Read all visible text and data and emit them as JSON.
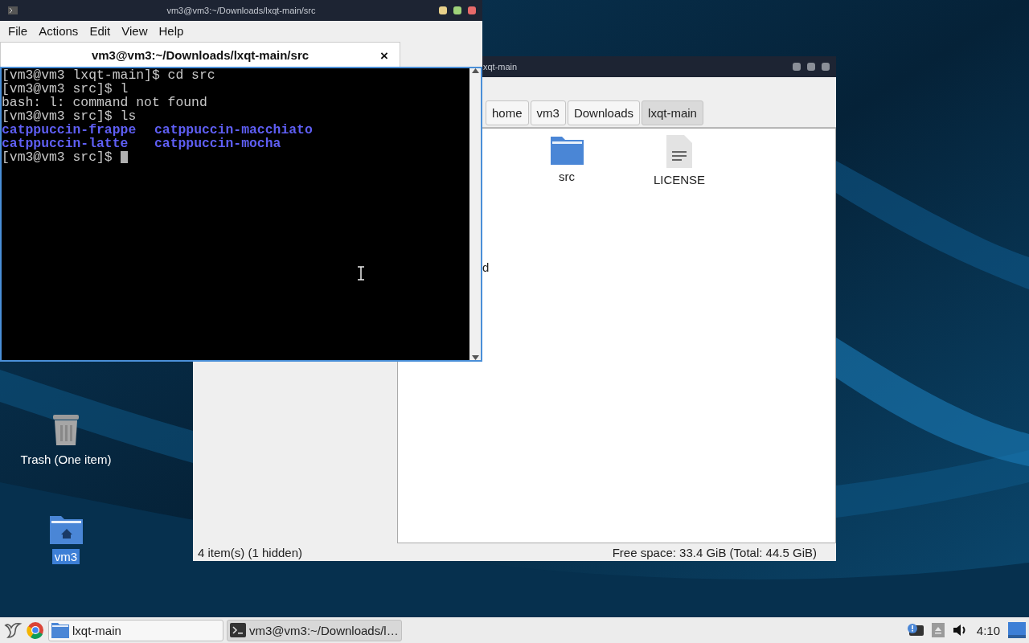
{
  "desktop": {
    "icons": [
      {
        "label": "Trash (One item)",
        "kind": "trash",
        "selected": false
      },
      {
        "label": "vm3",
        "kind": "home",
        "selected": true
      }
    ]
  },
  "file_manager": {
    "title": "xqt-main",
    "path": [
      {
        "label": "home",
        "selected": false
      },
      {
        "label": "vm3",
        "selected": false
      },
      {
        "label": "Downloads",
        "selected": false
      },
      {
        "label": "lxqt-main",
        "selected": true
      }
    ],
    "partial_item_label": "d",
    "items": [
      {
        "name": "src",
        "kind": "folder"
      },
      {
        "name": "LICENSE",
        "kind": "file"
      }
    ],
    "status_left": "4 item(s) (1 hidden)",
    "status_right": "Free space: 33.4 GiB (Total: 44.5 GiB)"
  },
  "terminal": {
    "title": "vm3@vm3:~/Downloads/lxqt-main/src",
    "menu": [
      "File",
      "Actions",
      "Edit",
      "View",
      "Help"
    ],
    "tabs": [
      {
        "label": "vm3@vm3:~/Downloads/lxqt-main/src",
        "selected": true,
        "close": "×"
      }
    ],
    "lines": [
      {
        "kind": "text",
        "text": "[vm3@vm3 lxqt-main]$ cd src"
      },
      {
        "kind": "text",
        "text": "[vm3@vm3 src]$ l"
      },
      {
        "kind": "text",
        "text": "bash: l: command not found"
      },
      {
        "kind": "text",
        "text": "[vm3@vm3 src]$ ls"
      },
      {
        "kind": "listing",
        "cells": [
          "catppuccin-frappe",
          "catppuccin-macchiato"
        ]
      },
      {
        "kind": "listing",
        "cells": [
          "catppuccin-latte",
          "catppuccin-mocha"
        ]
      },
      {
        "kind": "text",
        "text": "[vm3@vm3 src]$ ",
        "cursor": true
      }
    ]
  },
  "taskbar": {
    "tasks": [
      {
        "label": "lxqt-main",
        "kind": "folder",
        "selected": false
      },
      {
        "label": "vm3@vm3:~/Downloads/l…",
        "kind": "terminal",
        "selected": true
      }
    ],
    "clock": "4:10"
  }
}
